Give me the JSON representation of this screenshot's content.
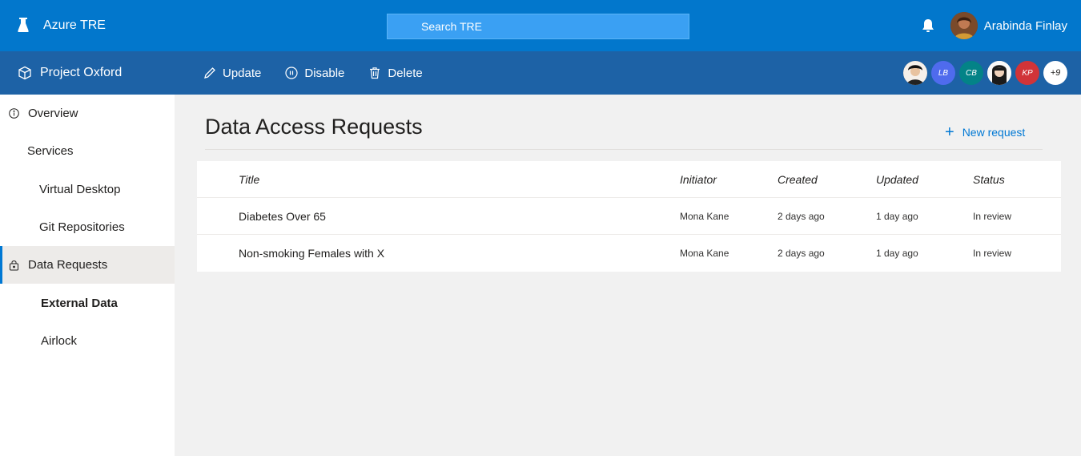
{
  "app": {
    "title": "Azure TRE"
  },
  "search": {
    "placeholder": "Search TRE"
  },
  "user": {
    "name": "Arabinda Finlay"
  },
  "project": {
    "name": "Project Oxford",
    "commands": [
      {
        "label": "Update",
        "icon": "pencil-icon"
      },
      {
        "label": "Disable",
        "icon": "pause-circle-icon"
      },
      {
        "label": "Delete",
        "icon": "trash-icon"
      }
    ],
    "members": [
      {
        "initials": "",
        "color": "#2b2b2b",
        "type": "photo"
      },
      {
        "initials": "LB",
        "color": "#4f6bed"
      },
      {
        "initials": "CB",
        "color": "#038387"
      },
      {
        "initials": "",
        "color": "#f3f2f1",
        "type": "photo"
      },
      {
        "initials": "KP",
        "color": "#d13438"
      },
      {
        "initials": "+9",
        "color": "#ffffff"
      }
    ]
  },
  "sidebar": {
    "items": [
      {
        "label": "Overview"
      },
      {
        "label": "Services"
      },
      {
        "label": "Virtual Desktop"
      },
      {
        "label": "Git Repositories"
      },
      {
        "label": "Data Requests"
      },
      {
        "label": "External Data"
      },
      {
        "label": "Airlock"
      }
    ]
  },
  "main": {
    "title": "Data Access Requests",
    "new_request_label": "New request",
    "table": {
      "headers": [
        "Title",
        "Initiator",
        "Created",
        "Updated",
        "Status"
      ],
      "rows": [
        [
          "Diabetes Over 65",
          "Mona Kane",
          "2 days ago",
          "1 day ago",
          "In review"
        ],
        [
          "Non-smoking Females with X",
          "Mona Kane",
          "2 days ago",
          "1 day ago",
          "In review"
        ]
      ]
    }
  },
  "colors": {
    "topbar": "#0277cc",
    "projectbar": "#1d62a6",
    "accent": "#0078d4"
  }
}
